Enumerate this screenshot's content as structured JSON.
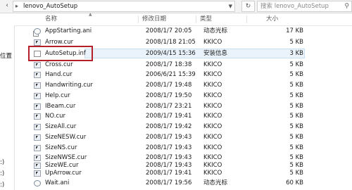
{
  "address": {
    "separator": "▸",
    "path": "lenovo_AutoSetup"
  },
  "search": {
    "placeholder": "搜索 lenovo_AutoSetup"
  },
  "navpane": {
    "fragments": [
      "位置",
      ":)",
      ":)",
      ":)"
    ]
  },
  "columns": {
    "name": "名称",
    "date": "修改日期",
    "type": "类型",
    "size": "大小"
  },
  "files": [
    {
      "name": "AppStarting.ani",
      "date": "2008/1/7 20:05",
      "type": "动态光标",
      "size": "17 KB",
      "icon": "ani"
    },
    {
      "name": "Arrow.cur",
      "date": "2008/1/18 21:05",
      "type": "KKICO",
      "size": "5 KB",
      "icon": "cur"
    },
    {
      "name": "AutoSetup.inf",
      "date": "2009/4/15 15:36",
      "type": "安装信息",
      "size": "3 KB",
      "icon": "inf"
    },
    {
      "name": "Cross.cur",
      "date": "2008/1/7 18:38",
      "type": "KKICO",
      "size": "5 KB",
      "icon": "cur"
    },
    {
      "name": "Hand.cur",
      "date": "2006/6/21 15:39",
      "type": "KKICO",
      "size": "5 KB",
      "icon": "cur"
    },
    {
      "name": "Handwriting.cur",
      "date": "2008/1/7 19:48",
      "type": "KKICO",
      "size": "5 KB",
      "icon": "cur"
    },
    {
      "name": "Help.cur",
      "date": "2008/1/7 19:50",
      "type": "KKICO",
      "size": "5 KB",
      "icon": "cur"
    },
    {
      "name": "IBeam.cur",
      "date": "2008/1/7 23:21",
      "type": "KKICO",
      "size": "5 KB",
      "icon": "cur"
    },
    {
      "name": "NO.cur",
      "date": "2008/1/7 19:41",
      "type": "KKICO",
      "size": "5 KB",
      "icon": "cur"
    },
    {
      "name": "SizeAll.cur",
      "date": "2008/1/7 19:42",
      "type": "KKICO",
      "size": "5 KB",
      "icon": "cur"
    },
    {
      "name": "SizeNESW.cur",
      "date": "2008/1/7 19:43",
      "type": "KKICO",
      "size": "5 KB",
      "icon": "cur"
    },
    {
      "name": "SizeNS.cur",
      "date": "2008/1/7 19:43",
      "type": "KKICO",
      "size": "5 KB",
      "icon": "cur"
    },
    {
      "name": "SizeNWSE.cur",
      "date": "2008/1/7 19:43",
      "type": "KKICO",
      "size": "5 KB",
      "icon": "cur"
    },
    {
      "name": "SizeWE.cur",
      "date": "2008/1/7 19:43",
      "type": "KKICO",
      "size": "5 KB",
      "icon": "cur"
    },
    {
      "name": "UpArrow.cur",
      "date": "2008/1/7 19:41",
      "type": "KKICO",
      "size": "5 KB",
      "icon": "cur"
    },
    {
      "name": "Wait.ani",
      "date": "2008/1/7 19:56",
      "type": "动态光标",
      "size": "60 KB",
      "icon": "ani"
    }
  ],
  "highlighted_file": "AutoSetup.inf",
  "colors": {
    "highlight_border": "#b3202a",
    "selection_fill": "#eaf3fb"
  }
}
